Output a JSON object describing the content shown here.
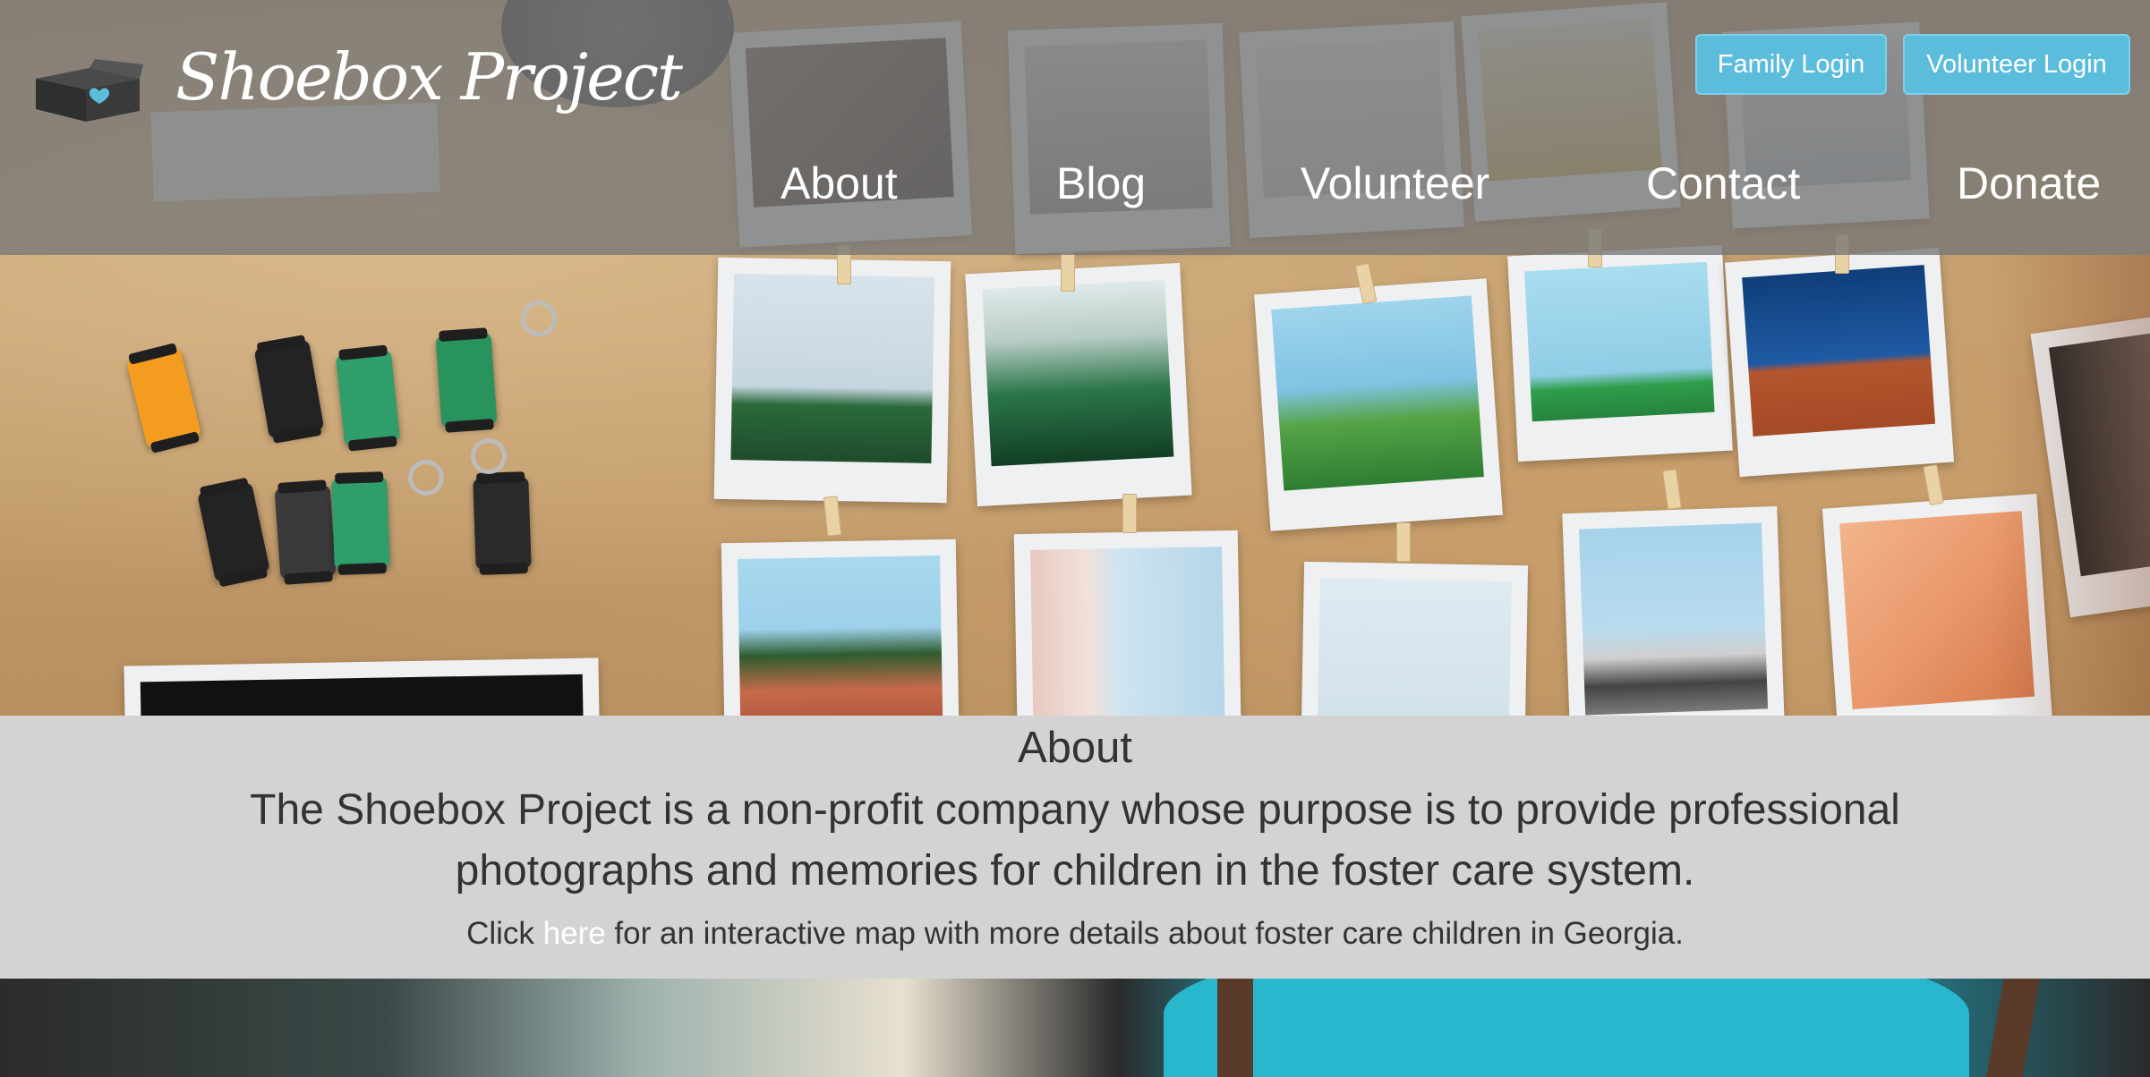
{
  "brand": {
    "name": "Shoebox Project",
    "logo_icon": "shoebox-heart-icon"
  },
  "header": {
    "family_login": "Family Login",
    "volunteer_login": "Volunteer Login",
    "nav": [
      {
        "label": "About"
      },
      {
        "label": "Blog"
      },
      {
        "label": "Volunteer"
      },
      {
        "label": "Contact"
      },
      {
        "label": "Donate"
      }
    ]
  },
  "about": {
    "heading": "About",
    "lead": "The Shoebox Project is a non-profit company whose purpose is to provide professional photographs and memories for children in the foster care system.",
    "cta_before": "Click ",
    "cta_link": "here",
    "cta_after": " for an interactive map with more details about foster care children in Georgia."
  },
  "colors": {
    "accent": "#5bbcdc",
    "header_overlay": "#767676",
    "about_bg": "#d3d3d3",
    "text": "#333333"
  }
}
